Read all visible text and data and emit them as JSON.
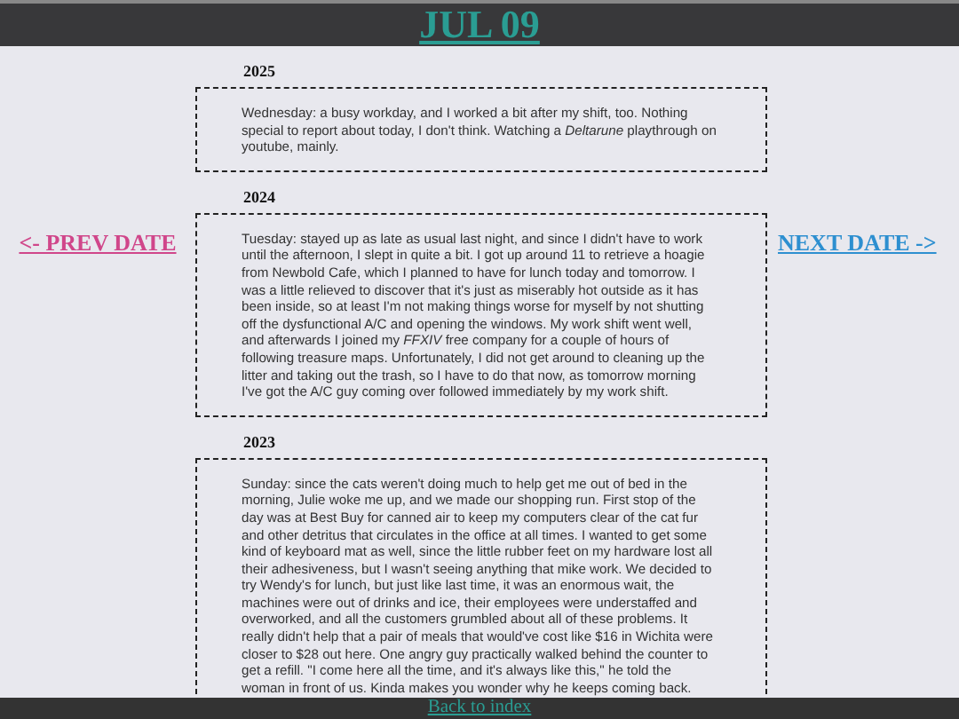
{
  "header": {
    "title": "JUL 09"
  },
  "prev_link": "<- PREV DATE",
  "next_link": "NEXT DATE ->",
  "entries": [
    {
      "year": "2025",
      "text": "Wednesday: a busy workday, and I worked a bit after my shift, too. Nothing special to report about today, I don't think. Watching a *Deltarune* playthrough on youtube, mainly."
    },
    {
      "year": "2024",
      "text": "Tuesday: stayed up as late as usual last night, and since I didn't have to work until the afternoon, I slept in quite a bit. I got up around 11 to retrieve a hoagie from Newbold Cafe, which I planned to have for lunch today and tomorrow. I was a little relieved to discover that it's just as miserably hot outside as it has been inside, so at least I'm not making things worse for myself by not shutting off the dysfunctional A/C and opening the windows. My work shift went well, and afterwards I joined my *FFXIV* free company for a couple of hours of following treasure maps. Unfortunately, I did not get around to cleaning up the litter and taking out the trash, so I have to do that now, as tomorrow morning I've got the A/C guy coming over followed immediately by my work shift."
    },
    {
      "year": "2023",
      "text": "Sunday: since the cats weren't doing much to help get me out of bed in the morning, Julie woke me up, and we made our shopping run. First stop of the day was at Best Buy for canned air to keep my computers clear of the cat fur and other detritus that circulates in the office at all times. I wanted to get some kind of keyboard mat as well, since the little rubber feet on my hardware lost all their adhesiveness, but I wasn't seeing anything that mike work. We decided to try Wendy's for lunch, but just like last time, it was an enormous wait, the machines were out of drinks and ice, their employees were understaffed and overworked, and all the customers grumbled about all of these problems. It really didn't help that a pair of meals that would've cost like $16 in Wichita were closer to $28 out here. One angry guy practically walked behind the counter to get a refill. \"I come here all the time, and it's always like this,\" he told the woman in front of us. Kinda makes you wonder why he keeps coming back."
    }
  ],
  "footer": {
    "link": "Back to index"
  }
}
